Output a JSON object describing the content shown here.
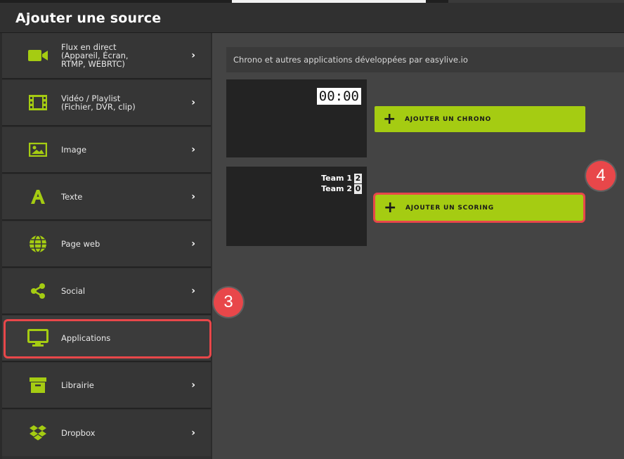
{
  "dialog": {
    "title": "Ajouter une source"
  },
  "sidebar": {
    "items": [
      {
        "label": "Flux en direct\n(Appareil, Écran,\nRTMP, WEBRTC)",
        "icon": "video-camera-icon"
      },
      {
        "label": "Vidéo / Playlist\n(Fichier, DVR, clip)",
        "icon": "film-icon"
      },
      {
        "label": "Image",
        "icon": "image-icon"
      },
      {
        "label": "Texte",
        "icon": "text-a-icon"
      },
      {
        "label": "Page web",
        "icon": "globe-icon"
      },
      {
        "label": "Social",
        "icon": "share-icon"
      },
      {
        "label": "Applications",
        "icon": "monitor-icon"
      },
      {
        "label": "Librairie",
        "icon": "archive-box-icon"
      },
      {
        "label": "Dropbox",
        "icon": "dropbox-icon"
      }
    ],
    "chevron": "›"
  },
  "main": {
    "heading": "Chrono et autres applications développées par easylive.io",
    "chrono": {
      "preview_time": "00:00",
      "button_plus": "+",
      "button_label": "AJOUTER UN CHRONO"
    },
    "scoring": {
      "teams": [
        {
          "name": "Team 1",
          "score": "2"
        },
        {
          "name": "Team 2",
          "score": "0"
        }
      ],
      "button_plus": "+",
      "button_label": "AJOUTER UN SCORING"
    }
  },
  "annotations": {
    "step3": "3",
    "step4": "4"
  },
  "colors": {
    "accent": "#a5cc12",
    "highlight": "#e8474a",
    "sidebar": "#363636",
    "main": "#444444"
  }
}
